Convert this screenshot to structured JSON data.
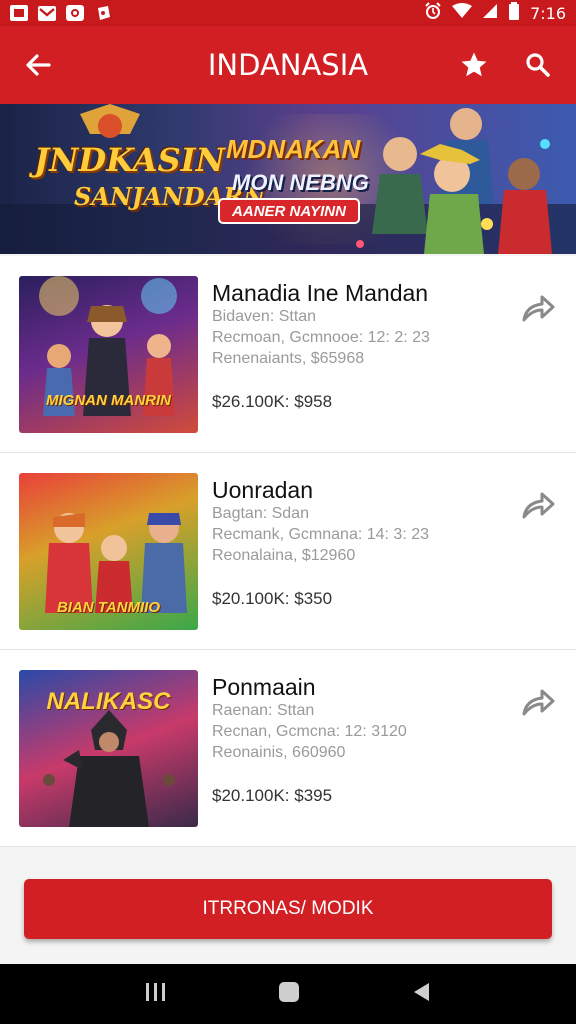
{
  "status_bar": {
    "time": "7:16"
  },
  "app_bar": {
    "title": "INDANASIA"
  },
  "banner": {
    "logo_line1": "JNDKASIN",
    "logo_line2": "SANJANDARN",
    "heading": "MDNAKAN",
    "subheading": "MON NEBNG",
    "button_label": "AANER NAYINN"
  },
  "cards": [
    {
      "title": "Manadia Ine Mandan",
      "line1": "Bidaven: Sttan",
      "line2": "Recmoan, Gcmnooe: 12: 2: 23",
      "line3": "Renenaiants, $65968",
      "price": "$26.100K: $958",
      "thumb_label": "MIGNAN MANRIN"
    },
    {
      "title": "Uonradan",
      "line1": "Bagtan: Sdan",
      "line2": "Recmank, Gcmnana: 14: 3: 23",
      "line3": "Reonalaina, $12960",
      "price": "$20.100K: $350",
      "thumb_label": "BIAN TANMIIO"
    },
    {
      "title": "Ponmaain",
      "line1": "Raenan: Sttan",
      "line2": "Recnan, Gcmcna: 12: 3120",
      "line3": "Reonainis, 660960",
      "price": "$20.100K: $395",
      "thumb_label": "NALIKASC"
    }
  ],
  "footer": {
    "button_label": "ITRRONAS/ MODIK"
  },
  "colors": {
    "primary": "#d21f24",
    "status_bar": "#c8191d"
  }
}
